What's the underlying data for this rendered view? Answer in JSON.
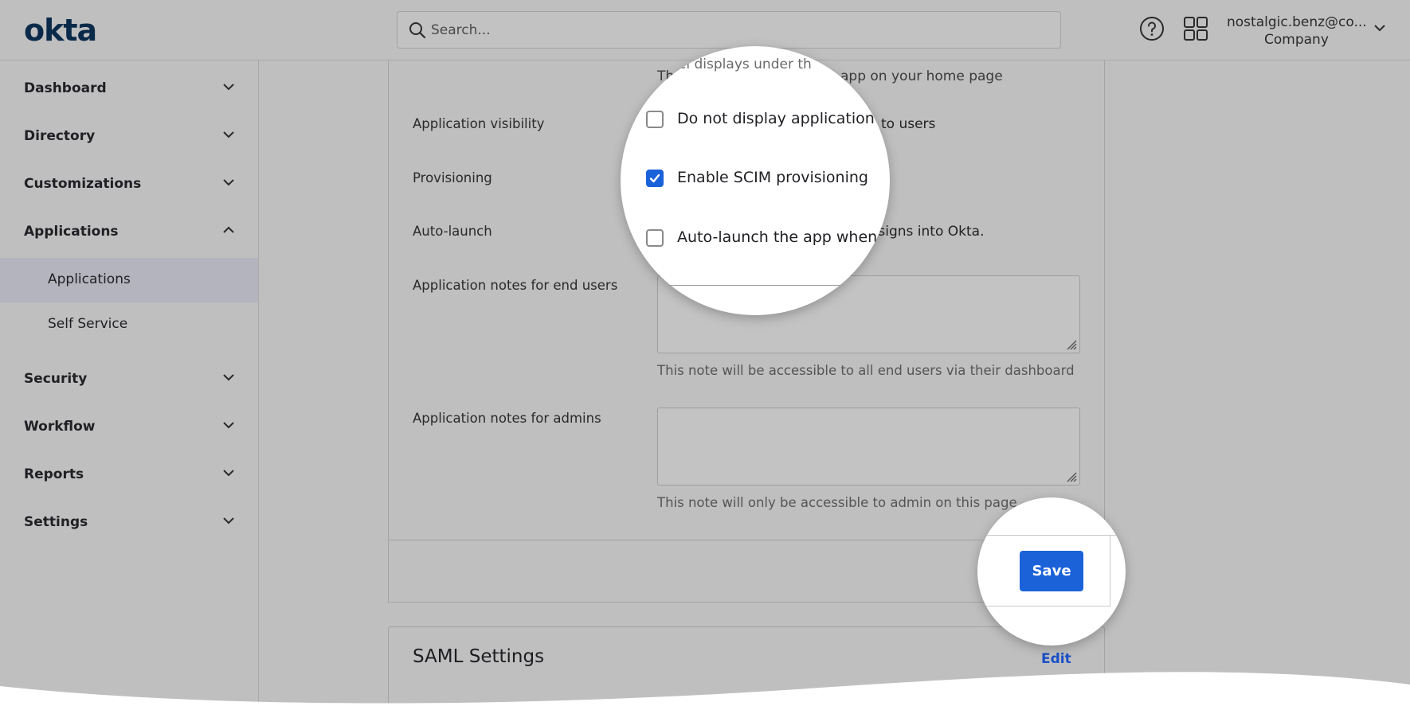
{
  "header": {
    "logo": "okta",
    "search_placeholder": "Search...",
    "user_name": "nostalgic.benz@co...",
    "user_org": "Company"
  },
  "sidebar": {
    "items": [
      {
        "label": "Dashboard",
        "expanded": false
      },
      {
        "label": "Directory",
        "expanded": false
      },
      {
        "label": "Customizations",
        "expanded": false
      },
      {
        "label": "Applications",
        "expanded": true
      },
      {
        "label": "Security",
        "expanded": false
      },
      {
        "label": "Workflow",
        "expanded": false
      },
      {
        "label": "Reports",
        "expanded": false
      },
      {
        "label": "Settings",
        "expanded": false
      }
    ],
    "sub_items": [
      {
        "label": "Applications",
        "active": true
      },
      {
        "label": "Self Service",
        "active": false
      }
    ]
  },
  "form": {
    "app_label_help": "The label displays under the app on your home page",
    "app_label_help_visible_left": "Th",
    "app_label_help_visible_right": "app on your home page",
    "visibility_label": "Application visibility",
    "visibility_tail": "to users",
    "provisioning_label": "Provisioning",
    "autolaunch_label": "Auto-launch",
    "autolaunch_tail": "r signs into Okta.",
    "notes_end_users_label": "Application notes for end users",
    "notes_end_users_help": "This note will be accessible to all end users via their dashboard",
    "notes_end_users_value": "",
    "notes_admins_label": "Application notes for admins",
    "notes_admins_help": "This note will only be accessible to admin on this page",
    "notes_admins_value": ""
  },
  "spotlight": {
    "label_top": "label displays under th",
    "checkboxes": [
      {
        "label": "Do not display application ic",
        "checked": false
      },
      {
        "label": "Enable SCIM provisioning",
        "checked": true
      },
      {
        "label": "Auto-launch the app when u",
        "checked": false
      }
    ],
    "save_label": "Save"
  },
  "saml": {
    "title": "SAML Settings",
    "edit_label": "Edit"
  },
  "colors": {
    "accent": "#1b62d9",
    "dim_background": "#bfbfbf",
    "logo": "#0a2a4a"
  }
}
